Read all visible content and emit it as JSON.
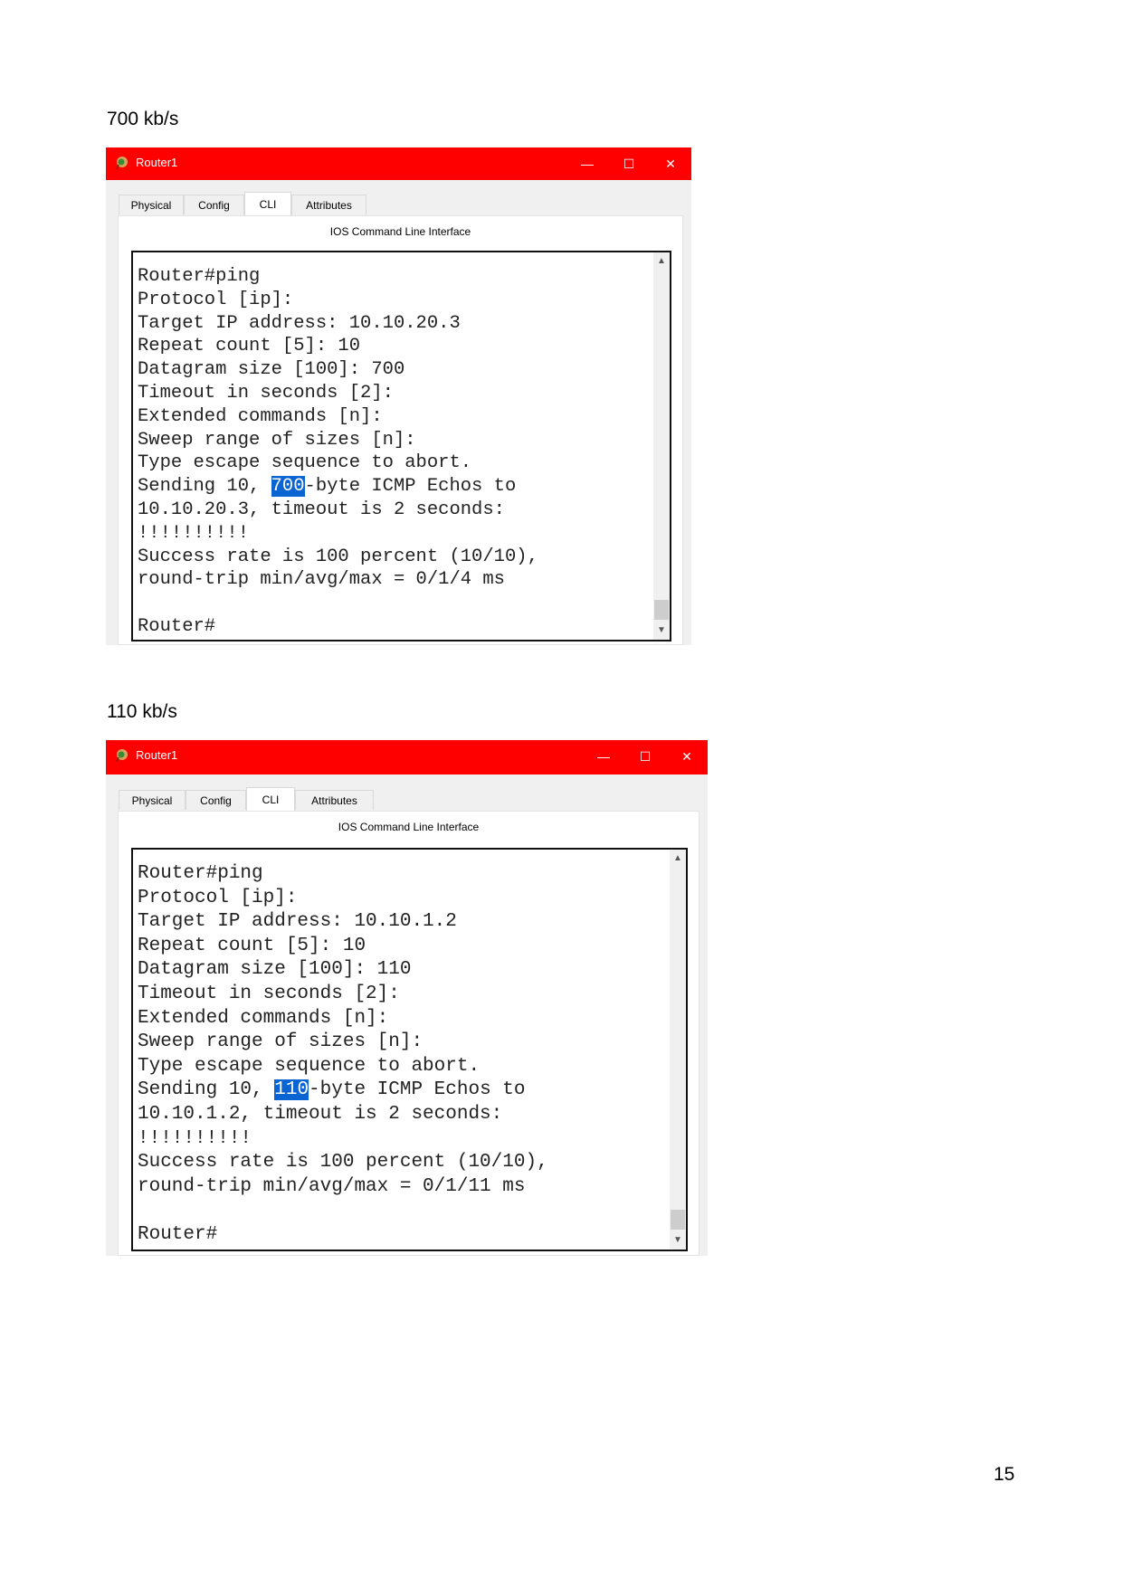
{
  "page_number": "15",
  "sections": [
    {
      "caption": "700 kb/s",
      "window": {
        "title": "Router1",
        "controls": {
          "minimize": "—",
          "maximize": "☐",
          "close": "✕"
        },
        "tabs": [
          {
            "label": "Physical",
            "active": false
          },
          {
            "label": "Config",
            "active": false
          },
          {
            "label": "CLI",
            "active": true
          },
          {
            "label": "Attributes",
            "active": false
          }
        ],
        "panel_title": "IOS Command Line Interface",
        "terminal": {
          "lines_before": [
            "Router#ping",
            "Protocol [ip]:",
            "Target IP address: 10.10.20.3",
            "Repeat count [5]: 10",
            "Datagram size [100]: 700",
            "Timeout in seconds [2]:",
            "Extended commands [n]:",
            "Sweep range of sizes [n]:",
            "Type escape sequence to abort."
          ],
          "sending_prefix": "Sending 10, ",
          "sending_highlight": "700",
          "sending_suffix": "-byte ICMP Echos to",
          "lines_after": [
            "10.10.20.3, timeout is 2 seconds:",
            "!!!!!!!!!!",
            "Success rate is 100 percent (10/10),",
            "round-trip min/avg/max = 0/1/4 ms",
            "",
            "Router#"
          ]
        }
      }
    },
    {
      "caption": "110 kb/s",
      "window": {
        "title": "Router1",
        "controls": {
          "minimize": "—",
          "maximize": "☐",
          "close": "✕"
        },
        "tabs": [
          {
            "label": "Physical",
            "active": false
          },
          {
            "label": "Config",
            "active": false
          },
          {
            "label": "CLI",
            "active": true
          },
          {
            "label": "Attributes",
            "active": false
          }
        ],
        "panel_title": "IOS Command Line Interface",
        "terminal": {
          "lines_before": [
            "Router#ping",
            "Protocol [ip]:",
            "Target IP address: 10.10.1.2",
            "Repeat count [5]: 10",
            "Datagram size [100]: 110",
            "Timeout in seconds [2]:",
            "Extended commands [n]:",
            "Sweep range of sizes [n]:",
            "Type escape sequence to abort."
          ],
          "sending_prefix": "Sending 10, ",
          "sending_highlight": "110",
          "sending_suffix": "-byte ICMP Echos to",
          "lines_after": [
            "10.10.1.2, timeout is 2 seconds:",
            "!!!!!!!!!!",
            "Success rate is 100 percent (10/10),",
            "round-trip min/avg/max = 0/1/11 ms",
            "",
            "Router#"
          ]
        }
      }
    }
  ],
  "accent_colors": {
    "titlebar": "#ff0000",
    "selection": "#0a64d2"
  }
}
